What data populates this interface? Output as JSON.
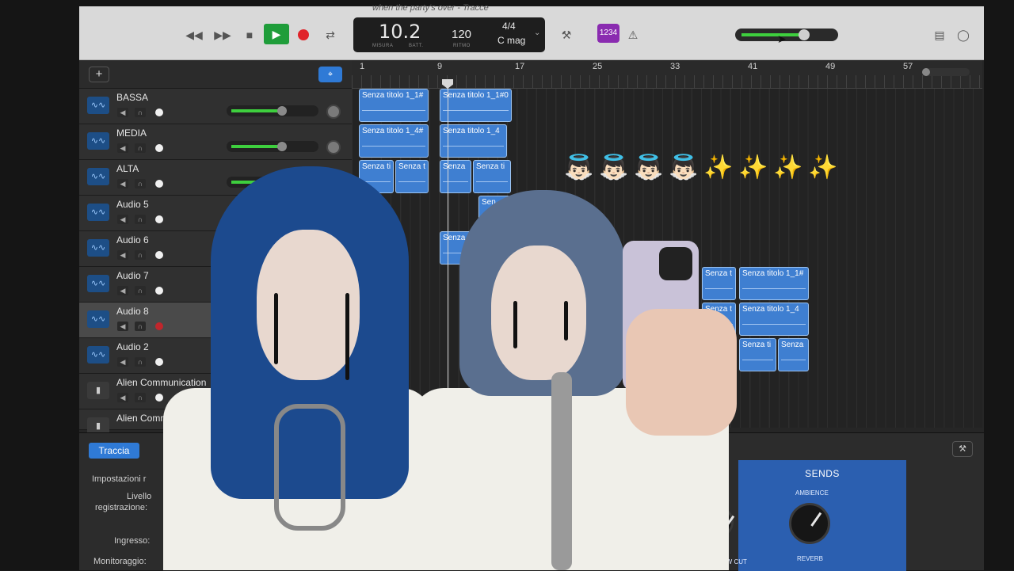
{
  "window": {
    "title": "when the party's over - Tracce"
  },
  "transport": {
    "measure_value": "10.2",
    "measure_label": "MISURA",
    "beat_label": "BATT.",
    "tempo": "120",
    "tempo_label": "RITMO",
    "time_signature": "4/4",
    "key": "C mag",
    "count_in_badge": "1234"
  },
  "volume": {
    "level": 0.66
  },
  "track_header": {
    "add_label": "+"
  },
  "ruler": {
    "marks": [
      "1",
      "9",
      "17",
      "25",
      "33",
      "41",
      "49",
      "57"
    ]
  },
  "tracks": [
    {
      "name": "BASSA"
    },
    {
      "name": "MEDIA"
    },
    {
      "name": "ALTA"
    },
    {
      "name": "Audio 5"
    },
    {
      "name": "Audio 6"
    },
    {
      "name": "Audio 7"
    },
    {
      "name": "Audio 8"
    },
    {
      "name": "Audio 2"
    },
    {
      "name": "Alien Communication"
    },
    {
      "name": "Alien Comm"
    }
  ],
  "regions": {
    "r1": "Senza titolo 1_1#",
    "r2": "Senza titolo 1_1#0",
    "r3": "Senza titolo 1_4#",
    "r4": "Senza titolo 1_4",
    "r5": "Senza ti",
    "r6": "Senza t",
    "r7": "Senza",
    "r8": "Senza ti",
    "r9": "Sen",
    "r10": "Senza",
    "r11": "Senza t",
    "r12": "Senza titolo 1_1#",
    "r13": "Senza t",
    "r14": "Senza titolo 1_4",
    "r15": "Senza ti",
    "r16": "Senza"
  },
  "emojis": [
    "👼🏻",
    "👼🏻",
    "👼🏻",
    "👼🏻",
    "✨",
    "✨",
    "✨",
    "✨"
  ],
  "inspector": {
    "tab_label": "Traccia",
    "settings_label": "Impostazioni r",
    "level_label": "Livello",
    "record_level_label": "registrazione:",
    "input_label": "Ingresso:",
    "monitor_label": "Monitoraggio:"
  },
  "sends": {
    "title": "SENDS",
    "ambience": "AMBIENCE",
    "reverb": "REVERB",
    "low_cut": "LOW CUT"
  }
}
